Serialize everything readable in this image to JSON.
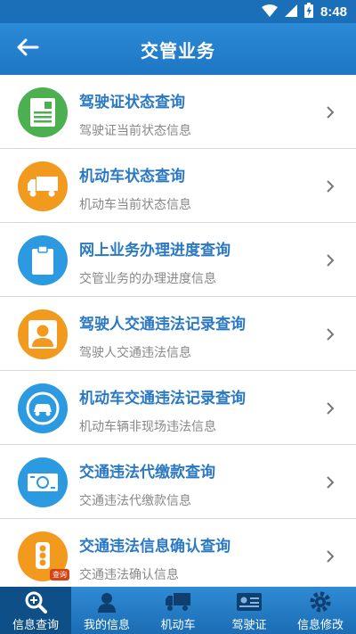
{
  "status_bar": {
    "time": "8:48"
  },
  "header": {
    "title": "交管业务"
  },
  "colors": {
    "header": "#2b8ad6",
    "title_text": "#2b79c2",
    "sub_text": "#888888"
  },
  "list": [
    {
      "title": "驾驶证状态查询",
      "subtitle": "驾驶证当前状态信息",
      "icon": "license-icon",
      "color": "#4caf50"
    },
    {
      "title": "机动车状态查询",
      "subtitle": "机动车当前状态信息",
      "icon": "truck-icon",
      "color": "#f29a1e"
    },
    {
      "title": "网上业务办理进度查询",
      "subtitle": "交管业务的办理进度信息",
      "icon": "clipboard-icon",
      "color": "#2c9ae0"
    },
    {
      "title": "驾驶人交通违法记录查询",
      "subtitle": "驾驶人交通违法信息",
      "icon": "driver-icon",
      "color": "#f29a1e"
    },
    {
      "title": "机动车交通违法记录查询",
      "subtitle": "机动车辆非现场违法信息",
      "icon": "car-icon",
      "color": "#2c9ae0"
    },
    {
      "title": "交通违法代缴款查询",
      "subtitle": "交通违法代缴款信息",
      "icon": "money-icon",
      "color": "#2c9ae0"
    },
    {
      "title": "交通违法信息确认查询",
      "subtitle": "交通违法确认信息",
      "icon": "traffic-light-icon",
      "color": "#f29a1e",
      "badge": "查询"
    }
  ],
  "bottom_nav": [
    {
      "label": "信息查询",
      "icon": "search-icon",
      "active": true
    },
    {
      "label": "我的信息",
      "icon": "user-icon",
      "active": false
    },
    {
      "label": "机动车",
      "icon": "vehicle-icon",
      "active": false
    },
    {
      "label": "驾驶证",
      "icon": "id-card-icon",
      "active": false
    },
    {
      "label": "信息修改",
      "icon": "settings-icon",
      "active": false
    }
  ]
}
